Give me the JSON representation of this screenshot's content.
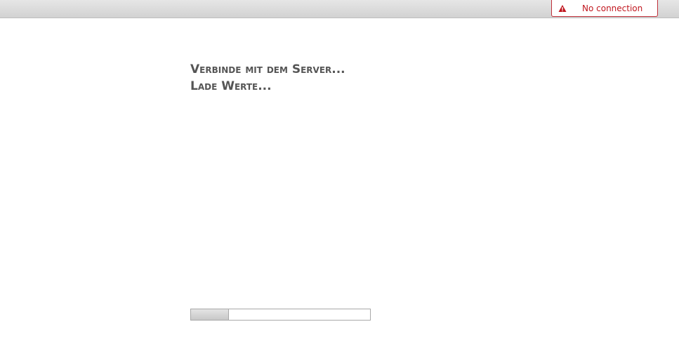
{
  "connection": {
    "status_text": "No connection",
    "icon": "warning-icon",
    "color": "#c0161e"
  },
  "status": {
    "line1": "Verbinde mit dem Server...",
    "line2": "Lade Werte..."
  },
  "progress": {
    "fraction": 0.21
  }
}
